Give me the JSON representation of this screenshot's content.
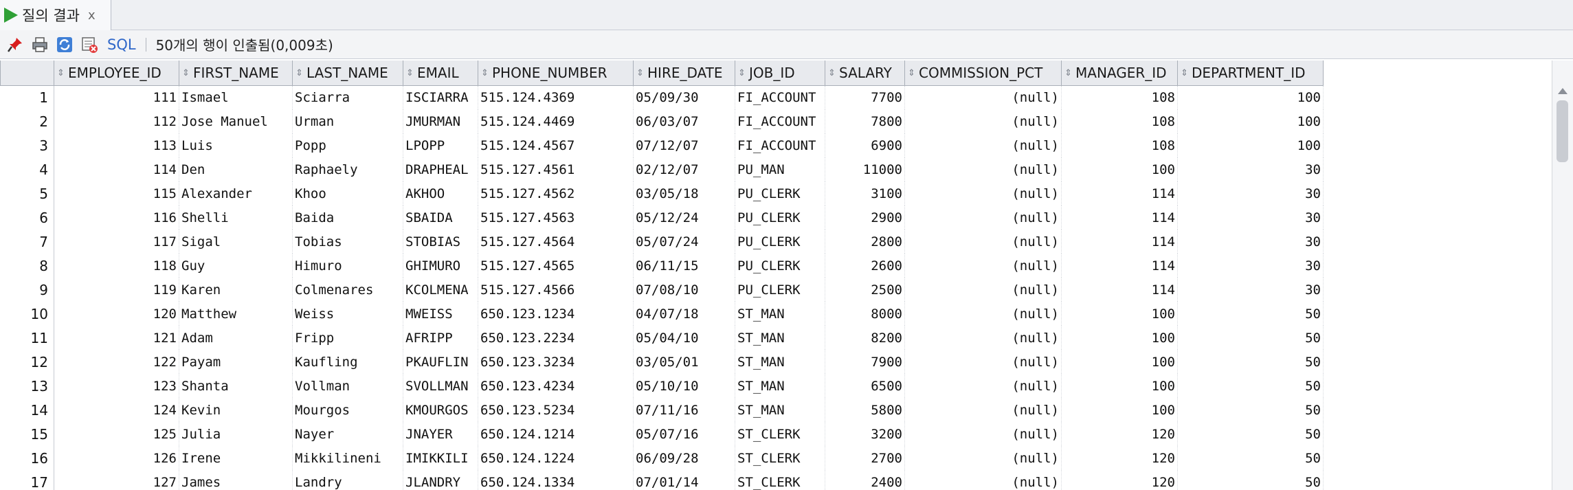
{
  "tab": {
    "label": "질의 결과",
    "close": "x"
  },
  "toolbar": {
    "sql_label": "SQL",
    "status": "50개의 행이 인출됨(0,009초)"
  },
  "columns": [
    "EMPLOYEE_ID",
    "FIRST_NAME",
    "LAST_NAME",
    "EMAIL",
    "PHONE_NUMBER",
    "HIRE_DATE",
    "JOB_ID",
    "SALARY",
    "COMMISSION_PCT",
    "MANAGER_ID",
    "DEPARTMENT_ID"
  ],
  "rows": [
    [
      "1",
      "111",
      "Ismael",
      "Sciarra",
      "ISCIARRA",
      "515.124.4369",
      "05/09/30",
      "FI_ACCOUNT",
      "7700",
      "(null)",
      "108",
      "100"
    ],
    [
      "2",
      "112",
      "Jose Manuel",
      "Urman",
      "JMURMAN",
      "515.124.4469",
      "06/03/07",
      "FI_ACCOUNT",
      "7800",
      "(null)",
      "108",
      "100"
    ],
    [
      "3",
      "113",
      "Luis",
      "Popp",
      "LPOPP",
      "515.124.4567",
      "07/12/07",
      "FI_ACCOUNT",
      "6900",
      "(null)",
      "108",
      "100"
    ],
    [
      "4",
      "114",
      "Den",
      "Raphaely",
      "DRAPHEAL",
      "515.127.4561",
      "02/12/07",
      "PU_MAN",
      "11000",
      "(null)",
      "100",
      "30"
    ],
    [
      "5",
      "115",
      "Alexander",
      "Khoo",
      "AKHOO",
      "515.127.4562",
      "03/05/18",
      "PU_CLERK",
      "3100",
      "(null)",
      "114",
      "30"
    ],
    [
      "6",
      "116",
      "Shelli",
      "Baida",
      "SBAIDA",
      "515.127.4563",
      "05/12/24",
      "PU_CLERK",
      "2900",
      "(null)",
      "114",
      "30"
    ],
    [
      "7",
      "117",
      "Sigal",
      "Tobias",
      "STOBIAS",
      "515.127.4564",
      "05/07/24",
      "PU_CLERK",
      "2800",
      "(null)",
      "114",
      "30"
    ],
    [
      "8",
      "118",
      "Guy",
      "Himuro",
      "GHIMURO",
      "515.127.4565",
      "06/11/15",
      "PU_CLERK",
      "2600",
      "(null)",
      "114",
      "30"
    ],
    [
      "9",
      "119",
      "Karen",
      "Colmenares",
      "KCOLMENA",
      "515.127.4566",
      "07/08/10",
      "PU_CLERK",
      "2500",
      "(null)",
      "114",
      "30"
    ],
    [
      "10",
      "120",
      "Matthew",
      "Weiss",
      "MWEISS",
      "650.123.1234",
      "04/07/18",
      "ST_MAN",
      "8000",
      "(null)",
      "100",
      "50"
    ],
    [
      "11",
      "121",
      "Adam",
      "Fripp",
      "AFRIPP",
      "650.123.2234",
      "05/04/10",
      "ST_MAN",
      "8200",
      "(null)",
      "100",
      "50"
    ],
    [
      "12",
      "122",
      "Payam",
      "Kaufling",
      "PKAUFLIN",
      "650.123.3234",
      "03/05/01",
      "ST_MAN",
      "7900",
      "(null)",
      "100",
      "50"
    ],
    [
      "13",
      "123",
      "Shanta",
      "Vollman",
      "SVOLLMAN",
      "650.123.4234",
      "05/10/10",
      "ST_MAN",
      "6500",
      "(null)",
      "100",
      "50"
    ],
    [
      "14",
      "124",
      "Kevin",
      "Mourgos",
      "KMOURGOS",
      "650.123.5234",
      "07/11/16",
      "ST_MAN",
      "5800",
      "(null)",
      "100",
      "50"
    ],
    [
      "15",
      "125",
      "Julia",
      "Nayer",
      "JNAYER",
      "650.124.1214",
      "05/07/16",
      "ST_CLERK",
      "3200",
      "(null)",
      "120",
      "50"
    ],
    [
      "16",
      "126",
      "Irene",
      "Mikkilineni",
      "IMIKKILI",
      "650.124.1224",
      "06/09/28",
      "ST_CLERK",
      "2700",
      "(null)",
      "120",
      "50"
    ],
    [
      "17",
      "127",
      "James",
      "Landry",
      "JLANDRY",
      "650.124.1334",
      "07/01/14",
      "ST_CLERK",
      "2400",
      "(null)",
      "120",
      "50"
    ]
  ]
}
